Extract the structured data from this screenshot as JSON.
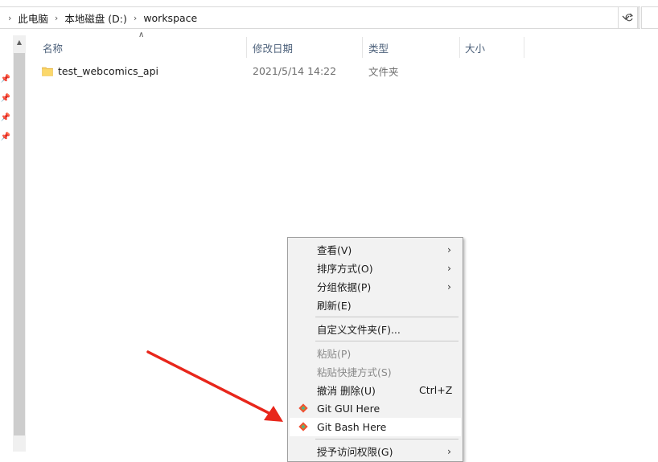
{
  "address_bar": {
    "crumbs": [
      "此电脑",
      "本地磁盘 (D:)",
      "workspace"
    ]
  },
  "columns": {
    "name": "名称",
    "modified": "修改日期",
    "type": "类型",
    "size": "大小"
  },
  "files": [
    {
      "name": "test_webcomics_api",
      "modified": "2021/5/14 14:22",
      "type": "文件夹",
      "size": ""
    }
  ],
  "context_menu": {
    "items": [
      {
        "label": "查看(V)",
        "submenu": true
      },
      {
        "label": "排序方式(O)",
        "submenu": true
      },
      {
        "label": "分组依据(P)",
        "submenu": true
      },
      {
        "label": "刷新(E)"
      },
      {
        "label": "自定义文件夹(F)..."
      },
      {
        "label": "粘贴(P)",
        "disabled": true
      },
      {
        "label": "粘贴快捷方式(S)",
        "disabled": true
      },
      {
        "label": "撤消 删除(U)",
        "shortcut": "Ctrl+Z"
      },
      {
        "label": "Git GUI Here",
        "icon": "git-icon"
      },
      {
        "label": "Git Bash Here",
        "icon": "git-icon",
        "highlighted": true
      },
      {
        "label": "授予访问权限(G)",
        "submenu": true
      }
    ]
  },
  "annotation": {
    "arrow_color": "#e8261b"
  },
  "colors": {
    "folder": "#f7cd5c",
    "header_text": "#4c607a"
  }
}
